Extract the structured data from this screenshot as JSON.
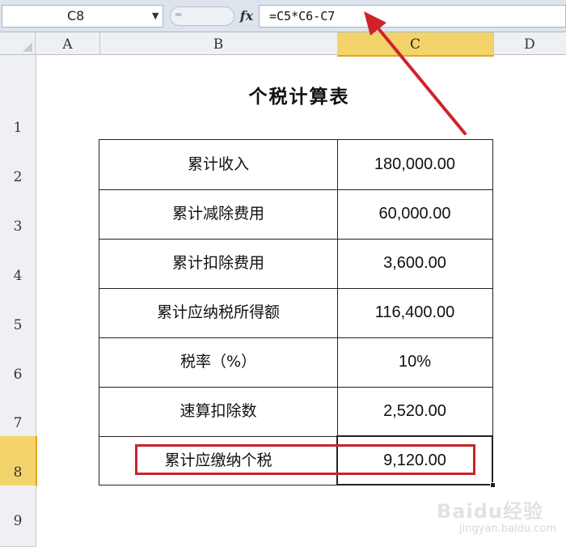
{
  "formula_bar": {
    "name_box": "C8",
    "fx_label": "fx",
    "formula": "=C5*C6-C7"
  },
  "columns": [
    "A",
    "B",
    "C",
    "D"
  ],
  "selected_column": "C",
  "rows": [
    "1",
    "2",
    "3",
    "4",
    "5",
    "6",
    "7",
    "8",
    "9"
  ],
  "selected_row": "8",
  "sheet": {
    "title": "个税计算表",
    "table": [
      {
        "label": "累计收入",
        "value": "180,000.00"
      },
      {
        "label": "累计减除费用",
        "value": "60,000.00"
      },
      {
        "label": "累计扣除费用",
        "value": "3,600.00"
      },
      {
        "label": "累计应纳税所得额",
        "value": "116,400.00"
      },
      {
        "label": "税率（%）",
        "value": "10%"
      },
      {
        "label": "速算扣除数",
        "value": "2,520.00"
      },
      {
        "label": "累计应缴纳个税",
        "value": "9,120.00"
      }
    ]
  },
  "colors": {
    "highlight_box": "#c8242b",
    "arrow": "#d0222b",
    "selected_header": "#f3d46a"
  },
  "watermark": {
    "brand": "Baidu经验",
    "url": "jingyan.baidu.com"
  }
}
